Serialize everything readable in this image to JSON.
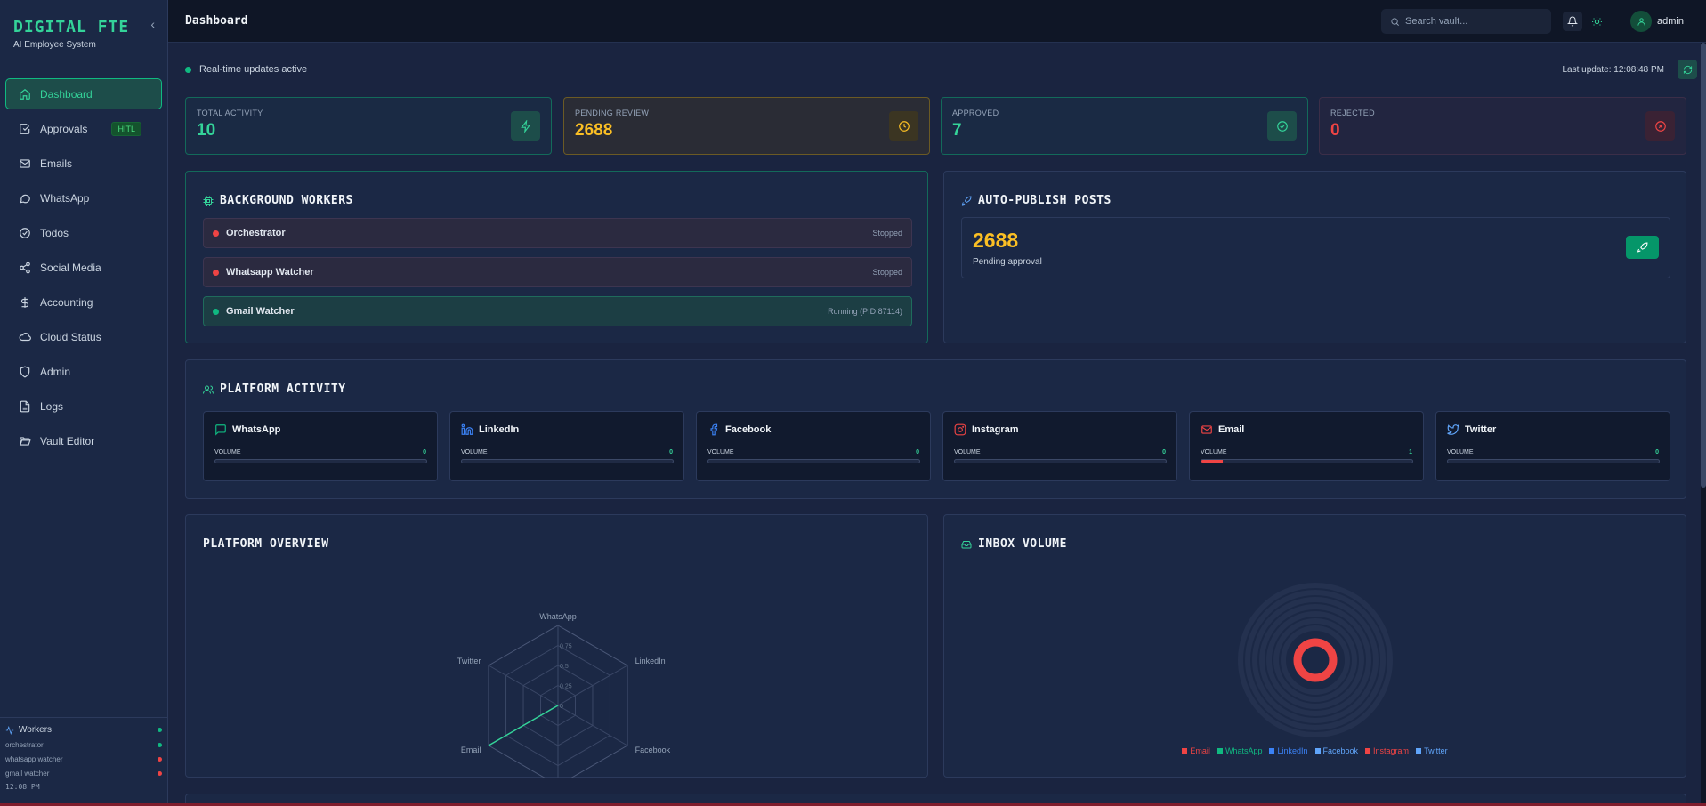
{
  "brand": {
    "title": "DIGITAL FTE",
    "subtitle": "AI Employee System"
  },
  "sidebar": {
    "items": [
      {
        "label": "Dashboard",
        "icon": "home-icon"
      },
      {
        "label": "Approvals",
        "icon": "check-square-icon",
        "badge": "HITL"
      },
      {
        "label": "Emails",
        "icon": "mail-icon"
      },
      {
        "label": "WhatsApp",
        "icon": "message-circle-icon"
      },
      {
        "label": "Todos",
        "icon": "check-circle-icon"
      },
      {
        "label": "Social Media",
        "icon": "share-icon"
      },
      {
        "label": "Accounting",
        "icon": "dollar-icon"
      },
      {
        "label": "Cloud Status",
        "icon": "cloud-icon"
      },
      {
        "label": "Admin",
        "icon": "shield-icon"
      },
      {
        "label": "Logs",
        "icon": "file-text-icon"
      },
      {
        "label": "Vault Editor",
        "icon": "folder-open-icon"
      }
    ],
    "workers": {
      "title": "Workers",
      "list": [
        {
          "name": "orchestrator",
          "status": "green"
        },
        {
          "name": "whatsapp watcher",
          "status": "red"
        },
        {
          "name": "gmail watcher",
          "status": "red"
        }
      ],
      "time": "12:08 PM"
    }
  },
  "header": {
    "title": "Dashboard",
    "search_placeholder": "Search vault...",
    "user": "admin"
  },
  "status": {
    "realtime": "Real-time updates active",
    "last_update": "Last update: 12:08:48 PM"
  },
  "stats": [
    {
      "label": "TOTAL ACTIVITY",
      "value": "10"
    },
    {
      "label": "PENDING REVIEW",
      "value": "2688"
    },
    {
      "label": "APPROVED",
      "value": "7"
    },
    {
      "label": "REJECTED",
      "value": "0"
    }
  ],
  "background_workers": {
    "title": "BACKGROUND WORKERS",
    "items": [
      {
        "name": "Orchestrator",
        "status": "Stopped"
      },
      {
        "name": "Whatsapp Watcher",
        "status": "Stopped"
      },
      {
        "name": "Gmail Watcher",
        "status": "Running (PID 87114)"
      }
    ]
  },
  "auto_publish": {
    "title": "AUTO-PUBLISH POSTS",
    "value": "2688",
    "label": "Pending approval"
  },
  "platform_activity": {
    "title": "PLATFORM ACTIVITY",
    "volume_label": "VOLUME",
    "platforms": [
      {
        "name": "WhatsApp",
        "volume": "0",
        "fill": 0
      },
      {
        "name": "LinkedIn",
        "volume": "0",
        "fill": 0
      },
      {
        "name": "Facebook",
        "volume": "0",
        "fill": 0
      },
      {
        "name": "Instagram",
        "volume": "0",
        "fill": 0
      },
      {
        "name": "Email",
        "volume": "1",
        "fill": 0.1
      },
      {
        "name": "Twitter",
        "volume": "0",
        "fill": 0
      }
    ]
  },
  "platform_overview": {
    "title": "PLATFORM OVERVIEW",
    "axes": [
      "WhatsApp",
      "LinkedIn",
      "Facebook",
      "Instagram",
      "Email",
      "Twitter"
    ],
    "ticks": [
      "0",
      "0.25",
      "0.5",
      "0.75"
    ],
    "values": [
      0,
      0,
      0,
      0,
      1,
      0
    ]
  },
  "inbox_volume": {
    "title": "INBOX VOLUME",
    "legend": [
      {
        "name": "Email",
        "color": "#ef4444"
      },
      {
        "name": "WhatsApp",
        "color": "#10b981"
      },
      {
        "name": "LinkedIn",
        "color": "#3b82f6"
      },
      {
        "name": "Facebook",
        "color": "#60a5fa"
      },
      {
        "name": "Instagram",
        "color": "#ef4444"
      },
      {
        "name": "Twitter",
        "color": "#60a5fa"
      }
    ]
  },
  "chart_data": [
    {
      "type": "radar",
      "categories": [
        "WhatsApp",
        "LinkedIn",
        "Facebook",
        "Instagram",
        "Email",
        "Twitter"
      ],
      "values": [
        0,
        0,
        0,
        0,
        1,
        0
      ],
      "ticks": [
        0,
        0.25,
        0.5,
        0.75
      ],
      "ylim": [
        0,
        1
      ]
    },
    {
      "type": "pie",
      "categories": [
        "Email",
        "WhatsApp",
        "LinkedIn",
        "Facebook",
        "Instagram",
        "Twitter"
      ],
      "values": [
        1,
        0,
        0,
        0,
        0,
        0
      ]
    }
  ]
}
